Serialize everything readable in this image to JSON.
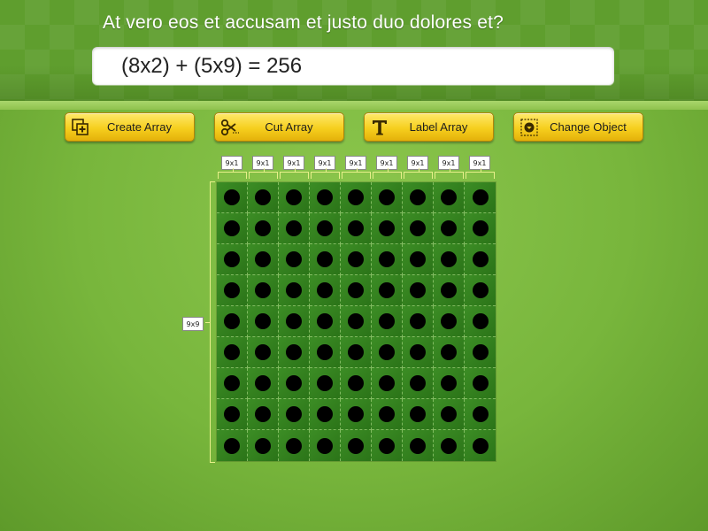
{
  "question": "At vero eos et accusam et justo duo dolores et?",
  "answer": "(8x2) + (5x9) = 256",
  "toolbar": {
    "create_label": "Create Array",
    "cut_label": "Cut Array",
    "label_label": "Label Array",
    "change_label": "Change Object"
  },
  "icons": {
    "create": "create-array-icon",
    "cut": "scissors-icon",
    "label": "letter-t-icon",
    "change": "change-object-icon"
  },
  "colors": {
    "button_face": "#f6cf1e",
    "cell_fill": "#3c8d25",
    "dot": "#000000",
    "bracket": "#e8f08a"
  },
  "array": {
    "rows": 9,
    "cols": 9,
    "row_label": "9x9",
    "column_labels": [
      "9x1",
      "9x1",
      "9x1",
      "9x1",
      "9x1",
      "9x1",
      "9x1",
      "9x1",
      "9x1"
    ]
  }
}
